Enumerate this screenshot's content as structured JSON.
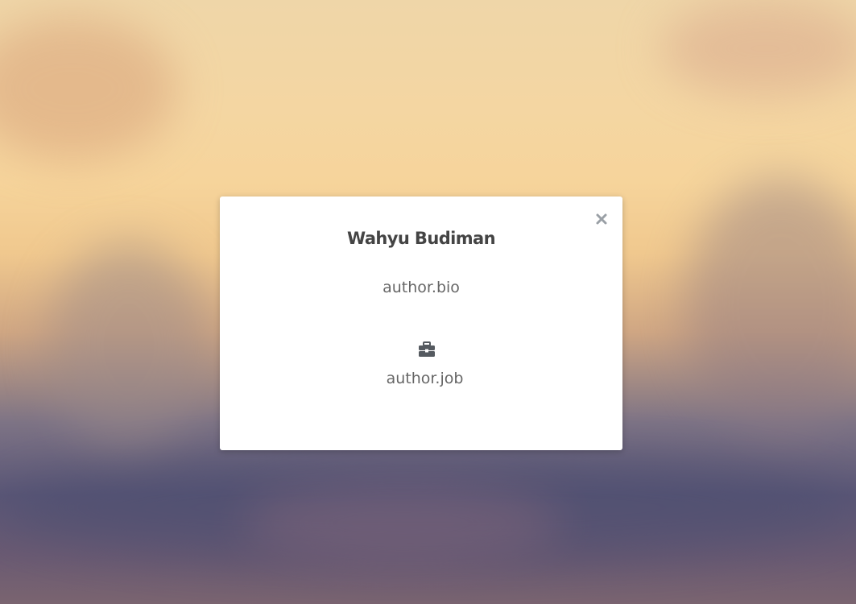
{
  "modal": {
    "name": "Wahyu Budiman",
    "bio": "author.bio",
    "job": "author.job",
    "close_icon": "close-icon",
    "job_icon": "briefcase-icon"
  },
  "colors": {
    "modal_bg": "#ffffff",
    "title_text": "#444444",
    "body_text": "#666666",
    "close_icon": "#9aa0a6",
    "job_icon": "#555a60"
  }
}
